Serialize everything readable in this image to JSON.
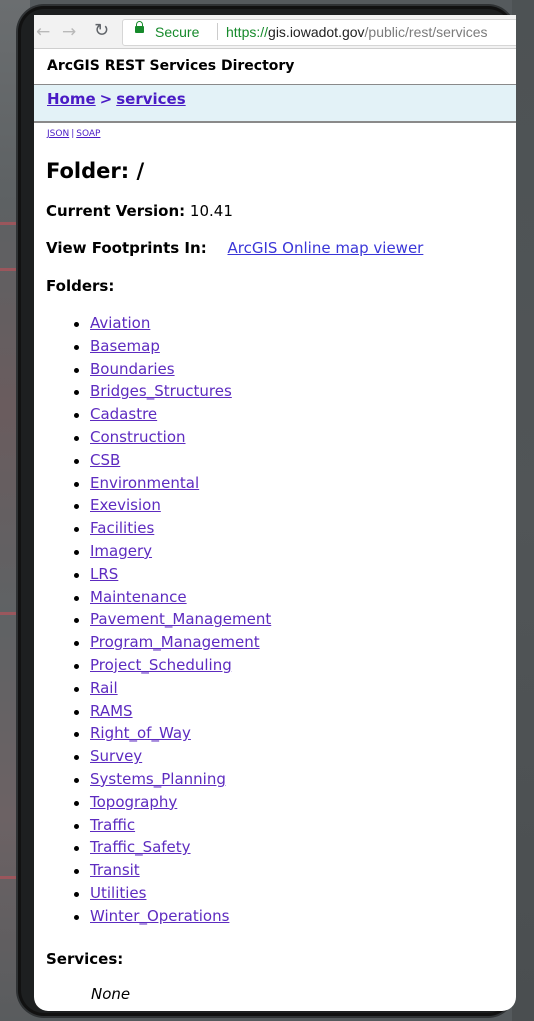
{
  "browser": {
    "back_icon": "back-arrow-icon",
    "forward_icon": "forward-arrow-icon",
    "reload_icon": "reload-icon",
    "secure_label": "Secure",
    "url_scheme": "https://",
    "url_host": "gis.iowadot.gov",
    "url_path": "/public/rest/services"
  },
  "page": {
    "directory_title": "ArcGIS REST Services Directory",
    "breadcrumb": {
      "home": "Home",
      "separator": ">",
      "services": "services"
    },
    "formats": {
      "json": "JSON",
      "separator": "|",
      "soap": "SOAP"
    },
    "folder_heading": "Folder: /",
    "current_version_label": "Current Version:",
    "current_version_value": "10.41",
    "view_footprints_label": "View Footprints In:",
    "view_footprints_link": "ArcGIS Online map viewer",
    "folders_heading": "Folders:",
    "folders": [
      "Aviation",
      "Basemap",
      "Boundaries",
      "Bridges_Structures",
      "Cadastre",
      "Construction",
      "CSB",
      "Environmental",
      "Exevision",
      "Facilities",
      "Imagery",
      "LRS",
      "Maintenance",
      "Pavement_Management",
      "Program_Management",
      "Project_Scheduling",
      "Rail",
      "RAMS",
      "Right_of_Way",
      "Survey",
      "Systems_Planning",
      "Topography",
      "Traffic",
      "Traffic_Safety",
      "Transit",
      "Utilities",
      "Winter_Operations"
    ],
    "services_heading": "Services:",
    "services_value": "None"
  },
  "colors": {
    "link": "#5d2bc0",
    "secure_green": "#168a2b",
    "navbar_bg": "#e3f2f7"
  }
}
